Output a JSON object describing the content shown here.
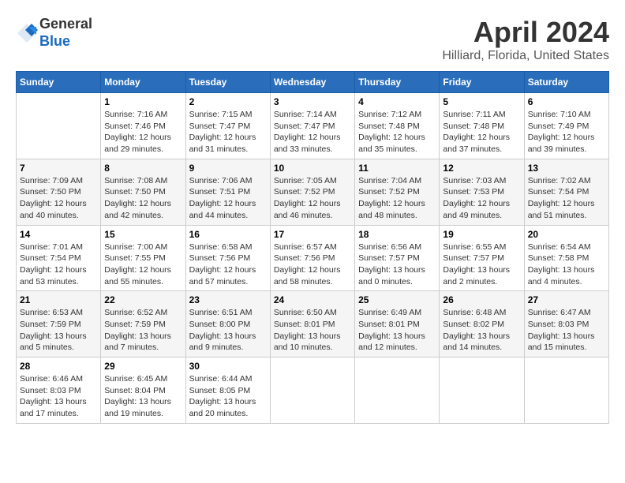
{
  "header": {
    "logo_line1": "General",
    "logo_line2": "Blue",
    "title": "April 2024",
    "subtitle": "Hilliard, Florida, United States"
  },
  "days_of_week": [
    "Sunday",
    "Monday",
    "Tuesday",
    "Wednesday",
    "Thursday",
    "Friday",
    "Saturday"
  ],
  "weeks": [
    [
      {
        "day": "",
        "info": ""
      },
      {
        "day": "1",
        "info": "Sunrise: 7:16 AM\nSunset: 7:46 PM\nDaylight: 12 hours\nand 29 minutes."
      },
      {
        "day": "2",
        "info": "Sunrise: 7:15 AM\nSunset: 7:47 PM\nDaylight: 12 hours\nand 31 minutes."
      },
      {
        "day": "3",
        "info": "Sunrise: 7:14 AM\nSunset: 7:47 PM\nDaylight: 12 hours\nand 33 minutes."
      },
      {
        "day": "4",
        "info": "Sunrise: 7:12 AM\nSunset: 7:48 PM\nDaylight: 12 hours\nand 35 minutes."
      },
      {
        "day": "5",
        "info": "Sunrise: 7:11 AM\nSunset: 7:48 PM\nDaylight: 12 hours\nand 37 minutes."
      },
      {
        "day": "6",
        "info": "Sunrise: 7:10 AM\nSunset: 7:49 PM\nDaylight: 12 hours\nand 39 minutes."
      }
    ],
    [
      {
        "day": "7",
        "info": "Sunrise: 7:09 AM\nSunset: 7:50 PM\nDaylight: 12 hours\nand 40 minutes."
      },
      {
        "day": "8",
        "info": "Sunrise: 7:08 AM\nSunset: 7:50 PM\nDaylight: 12 hours\nand 42 minutes."
      },
      {
        "day": "9",
        "info": "Sunrise: 7:06 AM\nSunset: 7:51 PM\nDaylight: 12 hours\nand 44 minutes."
      },
      {
        "day": "10",
        "info": "Sunrise: 7:05 AM\nSunset: 7:52 PM\nDaylight: 12 hours\nand 46 minutes."
      },
      {
        "day": "11",
        "info": "Sunrise: 7:04 AM\nSunset: 7:52 PM\nDaylight: 12 hours\nand 48 minutes."
      },
      {
        "day": "12",
        "info": "Sunrise: 7:03 AM\nSunset: 7:53 PM\nDaylight: 12 hours\nand 49 minutes."
      },
      {
        "day": "13",
        "info": "Sunrise: 7:02 AM\nSunset: 7:54 PM\nDaylight: 12 hours\nand 51 minutes."
      }
    ],
    [
      {
        "day": "14",
        "info": "Sunrise: 7:01 AM\nSunset: 7:54 PM\nDaylight: 12 hours\nand 53 minutes."
      },
      {
        "day": "15",
        "info": "Sunrise: 7:00 AM\nSunset: 7:55 PM\nDaylight: 12 hours\nand 55 minutes."
      },
      {
        "day": "16",
        "info": "Sunrise: 6:58 AM\nSunset: 7:56 PM\nDaylight: 12 hours\nand 57 minutes."
      },
      {
        "day": "17",
        "info": "Sunrise: 6:57 AM\nSunset: 7:56 PM\nDaylight: 12 hours\nand 58 minutes."
      },
      {
        "day": "18",
        "info": "Sunrise: 6:56 AM\nSunset: 7:57 PM\nDaylight: 13 hours\nand 0 minutes."
      },
      {
        "day": "19",
        "info": "Sunrise: 6:55 AM\nSunset: 7:57 PM\nDaylight: 13 hours\nand 2 minutes."
      },
      {
        "day": "20",
        "info": "Sunrise: 6:54 AM\nSunset: 7:58 PM\nDaylight: 13 hours\nand 4 minutes."
      }
    ],
    [
      {
        "day": "21",
        "info": "Sunrise: 6:53 AM\nSunset: 7:59 PM\nDaylight: 13 hours\nand 5 minutes."
      },
      {
        "day": "22",
        "info": "Sunrise: 6:52 AM\nSunset: 7:59 PM\nDaylight: 13 hours\nand 7 minutes."
      },
      {
        "day": "23",
        "info": "Sunrise: 6:51 AM\nSunset: 8:00 PM\nDaylight: 13 hours\nand 9 minutes."
      },
      {
        "day": "24",
        "info": "Sunrise: 6:50 AM\nSunset: 8:01 PM\nDaylight: 13 hours\nand 10 minutes."
      },
      {
        "day": "25",
        "info": "Sunrise: 6:49 AM\nSunset: 8:01 PM\nDaylight: 13 hours\nand 12 minutes."
      },
      {
        "day": "26",
        "info": "Sunrise: 6:48 AM\nSunset: 8:02 PM\nDaylight: 13 hours\nand 14 minutes."
      },
      {
        "day": "27",
        "info": "Sunrise: 6:47 AM\nSunset: 8:03 PM\nDaylight: 13 hours\nand 15 minutes."
      }
    ],
    [
      {
        "day": "28",
        "info": "Sunrise: 6:46 AM\nSunset: 8:03 PM\nDaylight: 13 hours\nand 17 minutes."
      },
      {
        "day": "29",
        "info": "Sunrise: 6:45 AM\nSunset: 8:04 PM\nDaylight: 13 hours\nand 19 minutes."
      },
      {
        "day": "30",
        "info": "Sunrise: 6:44 AM\nSunset: 8:05 PM\nDaylight: 13 hours\nand 20 minutes."
      },
      {
        "day": "",
        "info": ""
      },
      {
        "day": "",
        "info": ""
      },
      {
        "day": "",
        "info": ""
      },
      {
        "day": "",
        "info": ""
      }
    ]
  ]
}
